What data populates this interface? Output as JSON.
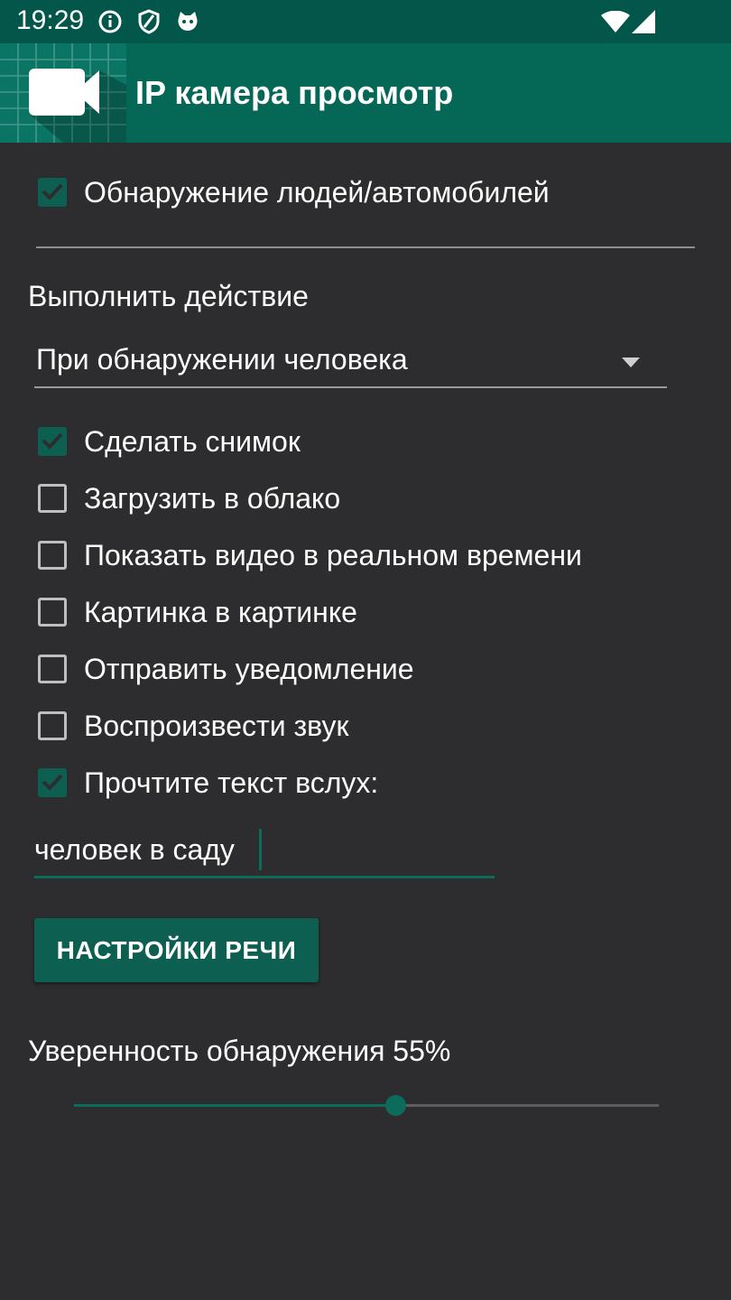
{
  "status_bar": {
    "time": "19:29",
    "icons": [
      "info-icon",
      "shield-icon",
      "cat-icon",
      "wifi-icon",
      "signal-icon"
    ]
  },
  "app_bar": {
    "title": "IP камера просмотр",
    "logo_icon": "video-camera-icon"
  },
  "detection": {
    "label": "Обнаружение людей/автомобилей",
    "checked": true
  },
  "action": {
    "section_label": "Выполнить действие",
    "selected": "При обнаружении человека"
  },
  "options": [
    {
      "label": "Сделать снимок",
      "checked": true
    },
    {
      "label": "Загрузить в облако",
      "checked": false
    },
    {
      "label": "Показать видео в реальном времени",
      "checked": false
    },
    {
      "label": "Картинка в картинке",
      "checked": false
    },
    {
      "label": "Отправить уведомление",
      "checked": false
    },
    {
      "label": "Воспроизвести звук",
      "checked": false
    },
    {
      "label": "Прочтите текст вслух:",
      "checked": true
    }
  ],
  "speech_text": {
    "value": "человек в саду"
  },
  "speech_settings_button": "НАСТРОЙКИ РЕЧИ",
  "confidence": {
    "label": "Уверенность обнаружения 55%",
    "value_percent": 55
  },
  "colors": {
    "status_bar": "#02574a",
    "app_bar": "#056756",
    "accent": "#0d6b5b",
    "background": "#2d2d2f"
  }
}
